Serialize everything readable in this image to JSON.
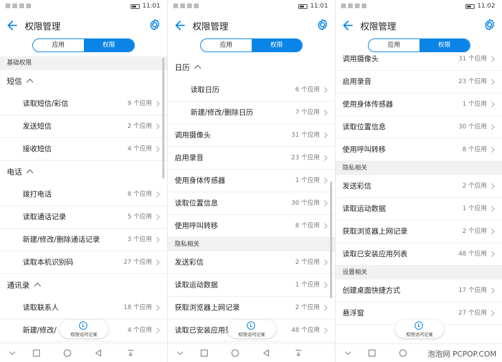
{
  "watermark": "泡泡网 PCPOP.COM",
  "colors": {
    "accent": "#0a84e6"
  },
  "icons": {
    "back": "arrow-left-icon",
    "settings": "gear-icon",
    "history": "clock-icon",
    "chevron": "chevron-right-icon"
  },
  "panels": [
    {
      "time": "11:01",
      "status_left": "",
      "title": "权限管理",
      "tabs": [
        "应用",
        "权限"
      ],
      "active_tab": 1,
      "fab_label": "权限访问记录",
      "rows": [
        {
          "kind": "section",
          "label": "基础权限"
        },
        {
          "kind": "group",
          "label": "短信"
        },
        {
          "kind": "sub",
          "label": "读取短信/彩信",
          "count": "9 个应用"
        },
        {
          "kind": "sub",
          "label": "发送短信",
          "count": "2 个应用"
        },
        {
          "kind": "sub",
          "label": "接收短信",
          "count": "4 个应用"
        },
        {
          "kind": "group",
          "label": "电话"
        },
        {
          "kind": "sub",
          "label": "拨打电话",
          "count": "8 个应用"
        },
        {
          "kind": "sub",
          "label": "读取通话记录",
          "count": "5 个应用"
        },
        {
          "kind": "sub",
          "label": "新建/修改/删除通话记录",
          "count": "3 个应用"
        },
        {
          "kind": "sub",
          "label": "读取本机识别码",
          "count": "27 个应用"
        },
        {
          "kind": "group",
          "label": "通讯录"
        },
        {
          "kind": "sub",
          "label": "读取联系人",
          "count": "18 个应用"
        },
        {
          "kind": "sub",
          "label": "新建/修改/",
          "count": "4 个应用"
        }
      ]
    },
    {
      "time": "11:01",
      "title": "权限管理",
      "tabs": [
        "应用",
        "权限"
      ],
      "active_tab": 1,
      "fab_label": "权限访问记录",
      "rows": [
        {
          "kind": "group",
          "label": "日历"
        },
        {
          "kind": "sub",
          "label": "读取日历",
          "count": "6 个应用"
        },
        {
          "kind": "sub",
          "label": "新建/修改/删除日历",
          "count": "7 个应用"
        },
        {
          "kind": "row",
          "label": "调用摄像头",
          "count": "31 个应用"
        },
        {
          "kind": "row",
          "label": "启用录音",
          "count": "23 个应用"
        },
        {
          "kind": "row",
          "label": "使用身体传感器",
          "count": "1 个应用"
        },
        {
          "kind": "row",
          "label": "读取位置信息",
          "count": "30 个应用"
        },
        {
          "kind": "row",
          "label": "使用呼叫转移",
          "count": "8 个应用"
        },
        {
          "kind": "section",
          "label": "隐私相关"
        },
        {
          "kind": "row",
          "label": "发送彩信",
          "count": "2 个应用"
        },
        {
          "kind": "row",
          "label": "读取运动数据",
          "count": "1 个应用"
        },
        {
          "kind": "row",
          "label": "获取浏览器上网记录",
          "count": "2 个应用"
        },
        {
          "kind": "row",
          "label": "读取已安装应用列",
          "count": "48 个应用"
        }
      ]
    },
    {
      "time": "11:02",
      "title": "权限管理",
      "tabs": [
        "应用",
        "权限"
      ],
      "active_tab": 1,
      "fab_label": "权限访问记录",
      "rows": [
        {
          "kind": "row",
          "label": "调用摄像头",
          "count": "31 个应用"
        },
        {
          "kind": "row",
          "label": "启用录音",
          "count": "23 个应用"
        },
        {
          "kind": "row",
          "label": "使用身体传感器",
          "count": "1 个应用"
        },
        {
          "kind": "row",
          "label": "读取位置信息",
          "count": "30 个应用"
        },
        {
          "kind": "row",
          "label": "使用呼叫转移",
          "count": "8 个应用"
        },
        {
          "kind": "section",
          "label": "隐私相关"
        },
        {
          "kind": "row",
          "label": "发送彩信",
          "count": "2 个应用"
        },
        {
          "kind": "row",
          "label": "读取运动数据",
          "count": "1 个应用"
        },
        {
          "kind": "row",
          "label": "获取浏览器上网记录",
          "count": "2 个应用"
        },
        {
          "kind": "row",
          "label": "读取已安装应用列表",
          "count": "48 个应用"
        },
        {
          "kind": "section",
          "label": "设置相关"
        },
        {
          "kind": "row",
          "label": "创建桌面快捷方式",
          "count": "17 个应用"
        },
        {
          "kind": "row",
          "label": "悬浮窗",
          "count": "27 个应用"
        }
      ]
    }
  ]
}
